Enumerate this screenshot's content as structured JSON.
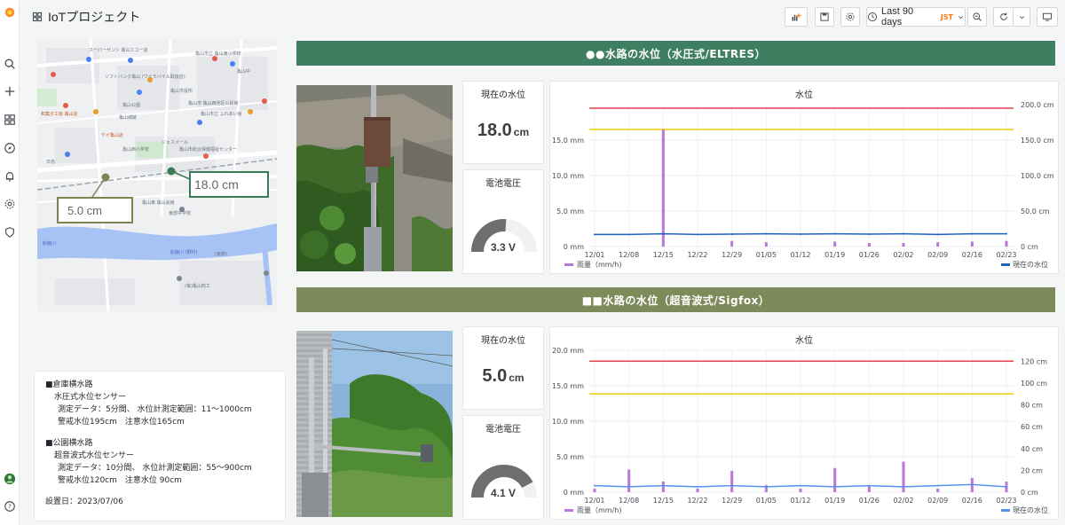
{
  "app": {
    "title": "IoTプロジェクト"
  },
  "toolbar": {
    "time_range": "Last 90 days",
    "timezone": "JST"
  },
  "map": {
    "labels": [
      {
        "text": "18.0 cm",
        "color": "#3b7a57"
      },
      {
        "text": "5.0 cm",
        "color": "#7d8451"
      }
    ],
    "place_names": [
      "スーパーサンシ 亀山エコー店",
      "ソフトバンク亀山 (ワイモバイル取扱店)",
      "亀山市立 亀山東小学校",
      "亀山市役所",
      "亀山中",
      "亀山公園",
      "亀山城跡",
      "和菓子工房 亀山店",
      "ケイ亀山店",
      "亀山市 亀山西地区公民館",
      "亀山市立 ふれあい館",
      "ジェスメール",
      "亀山市総合保健福祉センター",
      "亀山西小学校",
      "日赤",
      "鈴鹿川",
      "(東側)",
      "亀山東 亀山会館",
      "東部中学校",
      "(株)亀山商工",
      "鈴鹿川 (野村)"
    ]
  },
  "rows": [
    {
      "header": "●●水路の水位（水圧式/ELTRES）",
      "header_color": "#3f7f61",
      "current_title": "現在の水位",
      "current_value": "18.0",
      "current_unit": "cm",
      "battery_title": "電池電圧",
      "battery_value": "3.3 V",
      "chart_title": "水位"
    },
    {
      "header": "■■水路の水位（超音波式/Sigfox）",
      "header_color": "#7e8a5a",
      "current_title": "現在の水位",
      "current_value": "5.0",
      "current_unit": "cm",
      "battery_title": "電池電圧",
      "battery_value": "4.1 V",
      "chart_title": "水位"
    }
  ],
  "description": {
    "lines": [
      "■倉庫横水路",
      "水圧式水位センサー",
      "測定データ：5分間、 水位計測定範囲：11～1000cm",
      "警戒水位195cm　注意水位165cm",
      "",
      "■公園横水路",
      "超音波式水位センサー",
      "測定データ：10分間、 水位計測定範囲：55～900cm",
      "警戒水位120cm　注意水位 90cm",
      "",
      "設置日：2023/07/06"
    ]
  },
  "chart_data": [
    {
      "type": "line",
      "title": "水位",
      "x": [
        "12/01",
        "12/08",
        "12/15",
        "12/22",
        "12/29",
        "01/05",
        "01/12",
        "01/19",
        "01/26",
        "02/02",
        "02/09",
        "02/16",
        "02/23"
      ],
      "left_axis": {
        "ticks": [
          "0 mm",
          "5.0 mm",
          "10.0 mm",
          "15.0 mm"
        ],
        "ylim": [
          0,
          20
        ]
      },
      "right_axis": {
        "ticks": [
          "0 cm",
          "50.0 cm",
          "100.0 cm",
          "150.0 cm",
          "200.0 cm"
        ],
        "ylim": [
          0,
          200
        ]
      },
      "thresholds": [
        {
          "name": "警戒",
          "value": 195,
          "color": "#e0404f"
        },
        {
          "name": "注意",
          "value": 165,
          "color": "#f2cc0c"
        }
      ],
      "series": [
        {
          "name": "雨量（mm/h)",
          "color": "#b877d9",
          "axis": "left",
          "values": [
            0,
            0,
            16.5,
            0,
            0.8,
            0.6,
            0,
            0.7,
            0.5,
            0.5,
            0.6,
            0.7,
            0.8
          ]
        },
        {
          "name": "現在の水位",
          "color": "#1f60c4",
          "axis": "right",
          "values": [
            17,
            17,
            18,
            17,
            17.5,
            18,
            17.5,
            18,
            17.5,
            18,
            17,
            18,
            18
          ]
        }
      ],
      "legend": "bottom"
    },
    {
      "type": "line",
      "title": "水位",
      "x": [
        "12/01",
        "12/08",
        "12/15",
        "12/22",
        "12/29",
        "01/05",
        "01/12",
        "01/19",
        "01/26",
        "02/02",
        "02/09",
        "02/16",
        "02/23"
      ],
      "left_axis": {
        "ticks": [
          "0 mm",
          "5.0 mm",
          "10.0 mm",
          "15.0 mm",
          "20.0 mm"
        ],
        "ylim": [
          0,
          20
        ]
      },
      "right_axis": {
        "ticks": [
          "0 cm",
          "20 cm",
          "40 cm",
          "60 cm",
          "80 cm",
          "100 cm",
          "120 cm"
        ],
        "ylim": [
          0,
          130
        ]
      },
      "thresholds": [
        {
          "name": "警戒",
          "value": 120,
          "color": "#e0404f"
        },
        {
          "name": "注意",
          "value": 90,
          "color": "#f2cc0c"
        }
      ],
      "series": [
        {
          "name": "雨量（mm/h)",
          "color": "#b877d9",
          "axis": "left",
          "values": [
            0.5,
            3.2,
            1.5,
            0.5,
            3.0,
            1.0,
            0.5,
            3.4,
            1.0,
            4.3,
            0.5,
            2.0,
            1.5
          ]
        },
        {
          "name": "現在の水位",
          "color": "#5794f2",
          "axis": "right",
          "values": [
            6,
            5,
            6,
            5,
            6,
            5,
            6,
            5,
            6,
            5,
            6,
            7,
            5
          ]
        }
      ],
      "legend": "bottom"
    }
  ]
}
